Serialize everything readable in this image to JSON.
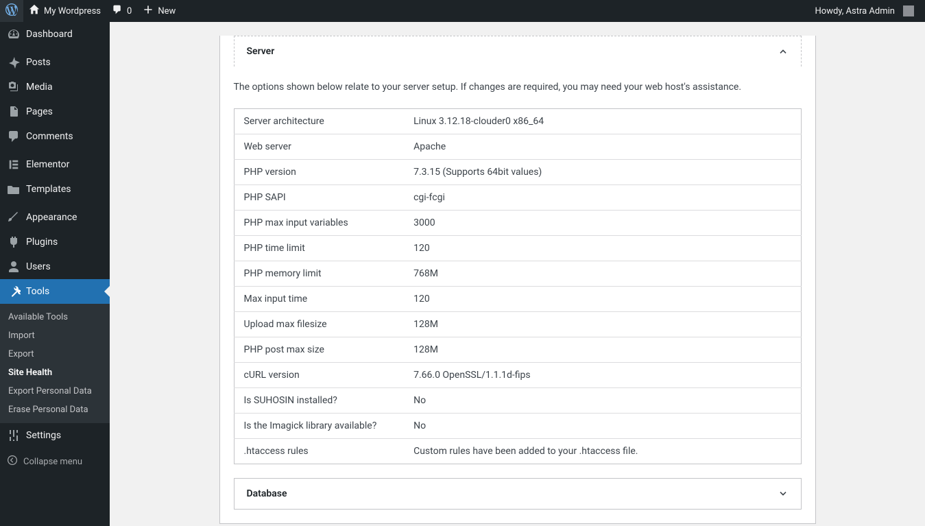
{
  "adminbar": {
    "site_name": "My Wordpress",
    "comments_count": "0",
    "new_label": "New",
    "howdy_prefix": "Howdy, ",
    "user_name": "Astra Admin"
  },
  "sidebar": {
    "items": [
      {
        "label": "Dashboard",
        "icon": "dashboard"
      },
      {
        "label": "Posts",
        "icon": "pin"
      },
      {
        "label": "Media",
        "icon": "media"
      },
      {
        "label": "Pages",
        "icon": "pages"
      },
      {
        "label": "Comments",
        "icon": "comment"
      },
      {
        "label": "Elementor",
        "icon": "elementor"
      },
      {
        "label": "Templates",
        "icon": "folder"
      },
      {
        "label": "Appearance",
        "icon": "brush"
      },
      {
        "label": "Plugins",
        "icon": "plugin"
      },
      {
        "label": "Users",
        "icon": "user"
      },
      {
        "label": "Tools",
        "icon": "wrench"
      },
      {
        "label": "Settings",
        "icon": "settings"
      }
    ],
    "submenu": [
      "Available Tools",
      "Import",
      "Export",
      "Site Health",
      "Export Personal Data",
      "Erase Personal Data"
    ],
    "collapse_label": "Collapse menu"
  },
  "sections": {
    "server": {
      "title": "Server",
      "description": "The options shown below relate to your server setup. If changes are required, you may need your web host's assistance.",
      "rows": [
        {
          "label": "Server architecture",
          "value": "Linux 3.12.18-clouder0 x86_64"
        },
        {
          "label": "Web server",
          "value": "Apache"
        },
        {
          "label": "PHP version",
          "value": "7.3.15 (Supports 64bit values)"
        },
        {
          "label": "PHP SAPI",
          "value": "cgi-fcgi"
        },
        {
          "label": "PHP max input variables",
          "value": "3000"
        },
        {
          "label": "PHP time limit",
          "value": "120"
        },
        {
          "label": "PHP memory limit",
          "value": "768M"
        },
        {
          "label": "Max input time",
          "value": "120"
        },
        {
          "label": "Upload max filesize",
          "value": "128M"
        },
        {
          "label": "PHP post max size",
          "value": "128M"
        },
        {
          "label": "cURL version",
          "value": "7.66.0 OpenSSL/1.1.1d-fips"
        },
        {
          "label": "Is SUHOSIN installed?",
          "value": "No"
        },
        {
          "label": "Is the Imagick library available?",
          "value": "No"
        },
        {
          "label": ".htaccess rules",
          "value": "Custom rules have been added to your .htaccess file."
        }
      ]
    },
    "database": {
      "title": "Database"
    }
  }
}
